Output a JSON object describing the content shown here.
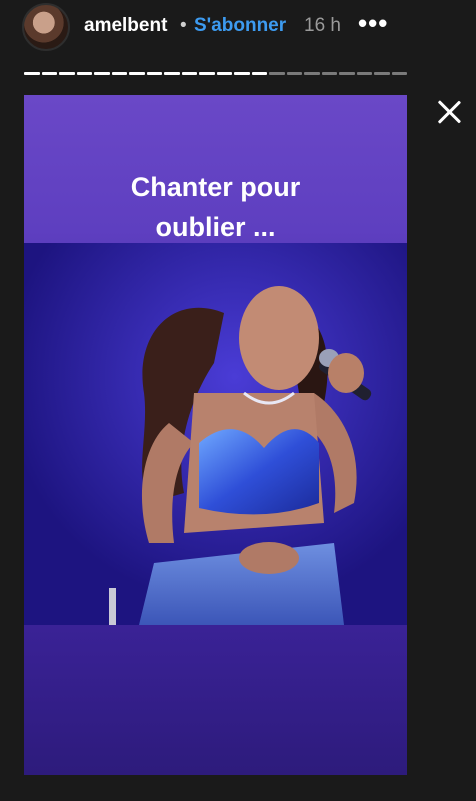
{
  "header": {
    "username": "amelbent",
    "separator": "•",
    "follow_label": "S'abonner",
    "time": "16 h",
    "more_label": "•••"
  },
  "progress": {
    "segments_total": 22,
    "segments_viewed": 14,
    "color_viewed": "#ffffff",
    "color_pending": "#7a7a7a"
  },
  "story": {
    "caption": "Chanter pour oublier ...",
    "caption_line1": "Chanter pour",
    "caption_line2": "oublier ..."
  },
  "icons": {
    "close": "close-icon",
    "more": "more-options-icon",
    "avatar": "avatar"
  },
  "colors": {
    "follow": "#3d9bf0",
    "background": "#1a1a1a",
    "story_bg": "#5e3fc0"
  }
}
